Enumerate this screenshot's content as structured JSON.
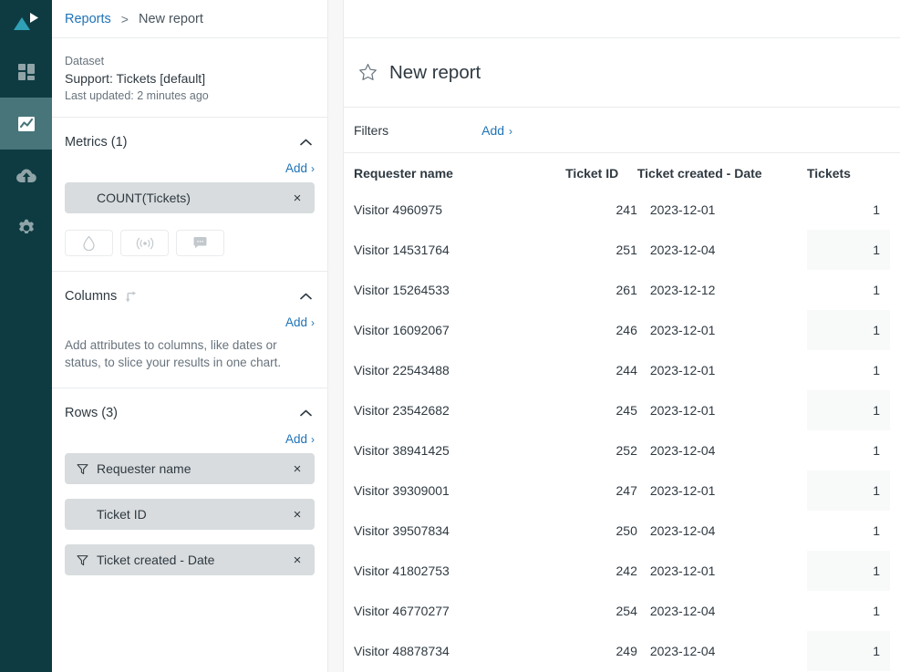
{
  "rail": {
    "logo_icon": "logo-triangle-play-icon",
    "items": [
      {
        "icon": "dashboard-grid-icon",
        "name": "dashboards",
        "active": false
      },
      {
        "icon": "line-chart-icon",
        "name": "reports",
        "active": true
      },
      {
        "icon": "cloud-upload-icon",
        "name": "data-imports",
        "active": false
      },
      {
        "icon": "gear-icon",
        "name": "settings",
        "active": false
      }
    ]
  },
  "breadcrumb": {
    "parent": "Reports",
    "separator": ">",
    "current": "New report"
  },
  "dataset": {
    "label": "Dataset",
    "name": "Support: Tickets [default]",
    "updated": "Last updated: 2 minutes ago"
  },
  "metrics": {
    "title": "Metrics (1)",
    "add_label": "Add",
    "add_chevron": "›",
    "collapse_icon": "chevron-up-icon",
    "items": [
      {
        "label": "COUNT(Tickets)",
        "has_filter_icon": false,
        "remove_label": "×"
      }
    ],
    "tool_buttons": [
      {
        "icon": "droplet-icon",
        "name": "color-picker-button"
      },
      {
        "icon": "broadcast-signal-icon",
        "name": "live-data-button"
      },
      {
        "icon": "comment-bubble-icon",
        "name": "annotation-button"
      }
    ]
  },
  "columns": {
    "title": "Columns",
    "swap_icon": "swap-arrow-icon",
    "add_label": "Add",
    "add_chevron": "›",
    "collapse_icon": "chevron-up-icon",
    "hint": "Add attributes to columns, like dates or status, to slice your results in one chart."
  },
  "rows": {
    "title": "Rows (3)",
    "add_label": "Add",
    "add_chevron": "›",
    "collapse_icon": "chevron-up-icon",
    "items": [
      {
        "label": "Requester name",
        "has_filter_icon": true,
        "remove_label": "×"
      },
      {
        "label": "Ticket ID",
        "has_filter_icon": false,
        "remove_label": "×"
      },
      {
        "label": "Ticket created - Date",
        "has_filter_icon": true,
        "remove_label": "×"
      }
    ]
  },
  "report": {
    "star_icon": "star-outline-icon",
    "title": "New report",
    "filters": {
      "label": "Filters",
      "add_label": "Add",
      "add_chevron": "›"
    }
  },
  "chart_data": {
    "type": "table",
    "title": "New report",
    "columns": [
      {
        "key": "requester_name",
        "label": "Requester name",
        "align": "left"
      },
      {
        "key": "ticket_id",
        "label": "Ticket ID",
        "align": "right"
      },
      {
        "key": "ticket_created_date",
        "label": "Ticket created - Date",
        "align": "left"
      },
      {
        "key": "tickets",
        "label": "Tickets",
        "align": "right"
      }
    ],
    "rows": [
      {
        "requester_name": "Visitor 4960975",
        "ticket_id": "241",
        "ticket_created_date": "2023-12-01",
        "tickets": "1"
      },
      {
        "requester_name": "Visitor 14531764",
        "ticket_id": "251",
        "ticket_created_date": "2023-12-04",
        "tickets": "1"
      },
      {
        "requester_name": "Visitor 15264533",
        "ticket_id": "261",
        "ticket_created_date": "2023-12-12",
        "tickets": "1"
      },
      {
        "requester_name": "Visitor 16092067",
        "ticket_id": "246",
        "ticket_created_date": "2023-12-01",
        "tickets": "1"
      },
      {
        "requester_name": "Visitor 22543488",
        "ticket_id": "244",
        "ticket_created_date": "2023-12-01",
        "tickets": "1"
      },
      {
        "requester_name": "Visitor 23542682",
        "ticket_id": "245",
        "ticket_created_date": "2023-12-01",
        "tickets": "1"
      },
      {
        "requester_name": "Visitor 38941425",
        "ticket_id": "252",
        "ticket_created_date": "2023-12-04",
        "tickets": "1"
      },
      {
        "requester_name": "Visitor 39309001",
        "ticket_id": "247",
        "ticket_created_date": "2023-12-01",
        "tickets": "1"
      },
      {
        "requester_name": "Visitor 39507834",
        "ticket_id": "250",
        "ticket_created_date": "2023-12-04",
        "tickets": "1"
      },
      {
        "requester_name": "Visitor 41802753",
        "ticket_id": "242",
        "ticket_created_date": "2023-12-01",
        "tickets": "1"
      },
      {
        "requester_name": "Visitor 46770277",
        "ticket_id": "254",
        "ticket_created_date": "2023-12-04",
        "tickets": "1"
      },
      {
        "requester_name": "Visitor 48878734",
        "ticket_id": "249",
        "ticket_created_date": "2023-12-04",
        "tickets": "1"
      }
    ],
    "metric": "COUNT(Tickets)",
    "grid": false,
    "legend": "none"
  },
  "colors": {
    "rail_background": "#0e3b42",
    "rail_active": "#47757a",
    "logo_accent": "#2fa0b5",
    "link_blue": "#1f73b7",
    "text_primary": "#2f3941",
    "text_muted": "#68737d",
    "pill_background": "#d8dcde",
    "zebra": "#f8f9f9",
    "border": "#e9ebed"
  }
}
